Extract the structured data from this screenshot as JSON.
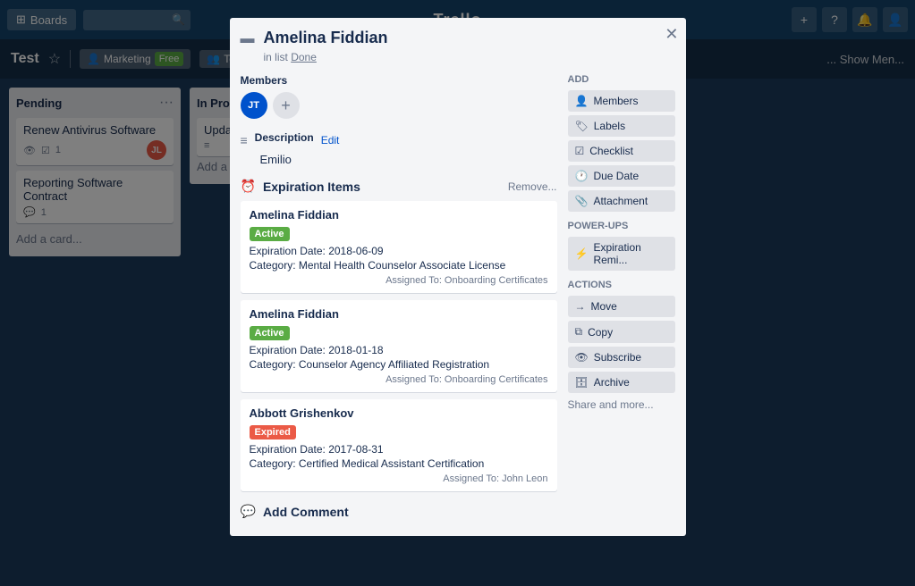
{
  "topnav": {
    "boards_label": "Boards",
    "search_placeholder": "",
    "logo": "Trello"
  },
  "board": {
    "title": "Test",
    "workspace": "Marketing",
    "free_label": "Free",
    "team_label": "Team Visible",
    "show_menu_label": "... Show Men..."
  },
  "lists": [
    {
      "id": "pending",
      "title": "Pending",
      "cards": [
        {
          "title": "Renew Antivirus Software",
          "has_desc": true,
          "has_checklist": true,
          "comments": 1,
          "avatar": "JL"
        },
        {
          "title": "Reporting Software Contract",
          "has_desc": false,
          "has_checklist": false,
          "comments": 1
        }
      ],
      "add_card_label": "Add a card..."
    },
    {
      "id": "in-progress",
      "title": "In Progress",
      "cards": [
        {
          "title": "Update C...",
          "has_desc": true
        }
      ],
      "add_card_label": "Add a card..."
    }
  ],
  "modal": {
    "title": "Amelina Fiddian",
    "in_list_label": "in list",
    "list_name": "Done",
    "members_label": "Members",
    "member_initials": "JT",
    "description_label": "Description",
    "edit_label": "Edit",
    "description_text": "Emilio",
    "expiration_label": "Expiration Items",
    "remove_label": "Remove...",
    "expiration_items": [
      {
        "name": "Amelina Fiddian",
        "status": "Active",
        "status_type": "active",
        "expiration_date": "Expiration Date: 2018-06-09",
        "category": "Category: Mental Health Counselor Associate License",
        "assigned_to": "Assigned To: Onboarding Certificates"
      },
      {
        "name": "Amelina Fiddian",
        "status": "Active",
        "status_type": "active",
        "expiration_date": "Expiration Date: 2018-01-18",
        "category": "Category: Counselor Agency Affiliated Registration",
        "assigned_to": "Assigned To: Onboarding Certificates"
      },
      {
        "name": "Abbott Grishenkov",
        "status": "Expired",
        "status_type": "expired",
        "expiration_date": "Expiration Date: 2017-08-31",
        "category": "Category: Certified Medical Assistant Certification",
        "assigned_to": "Assigned To: John Leon"
      }
    ],
    "add_comment_label": "Add Comment",
    "add_section": {
      "title": "Add",
      "members_btn": "Members",
      "labels_btn": "Labels",
      "checklist_btn": "Checklist",
      "due_date_btn": "Due Date",
      "attachment_btn": "Attachment"
    },
    "power_ups_section": {
      "title": "Power-Ups",
      "expiration_btn": "Expiration Remi..."
    },
    "actions_section": {
      "title": "Actions",
      "move_btn": "Move",
      "copy_btn": "Copy",
      "subscribe_btn": "Subscribe",
      "archive_btn": "Archive"
    },
    "share_label": "Share and more..."
  }
}
